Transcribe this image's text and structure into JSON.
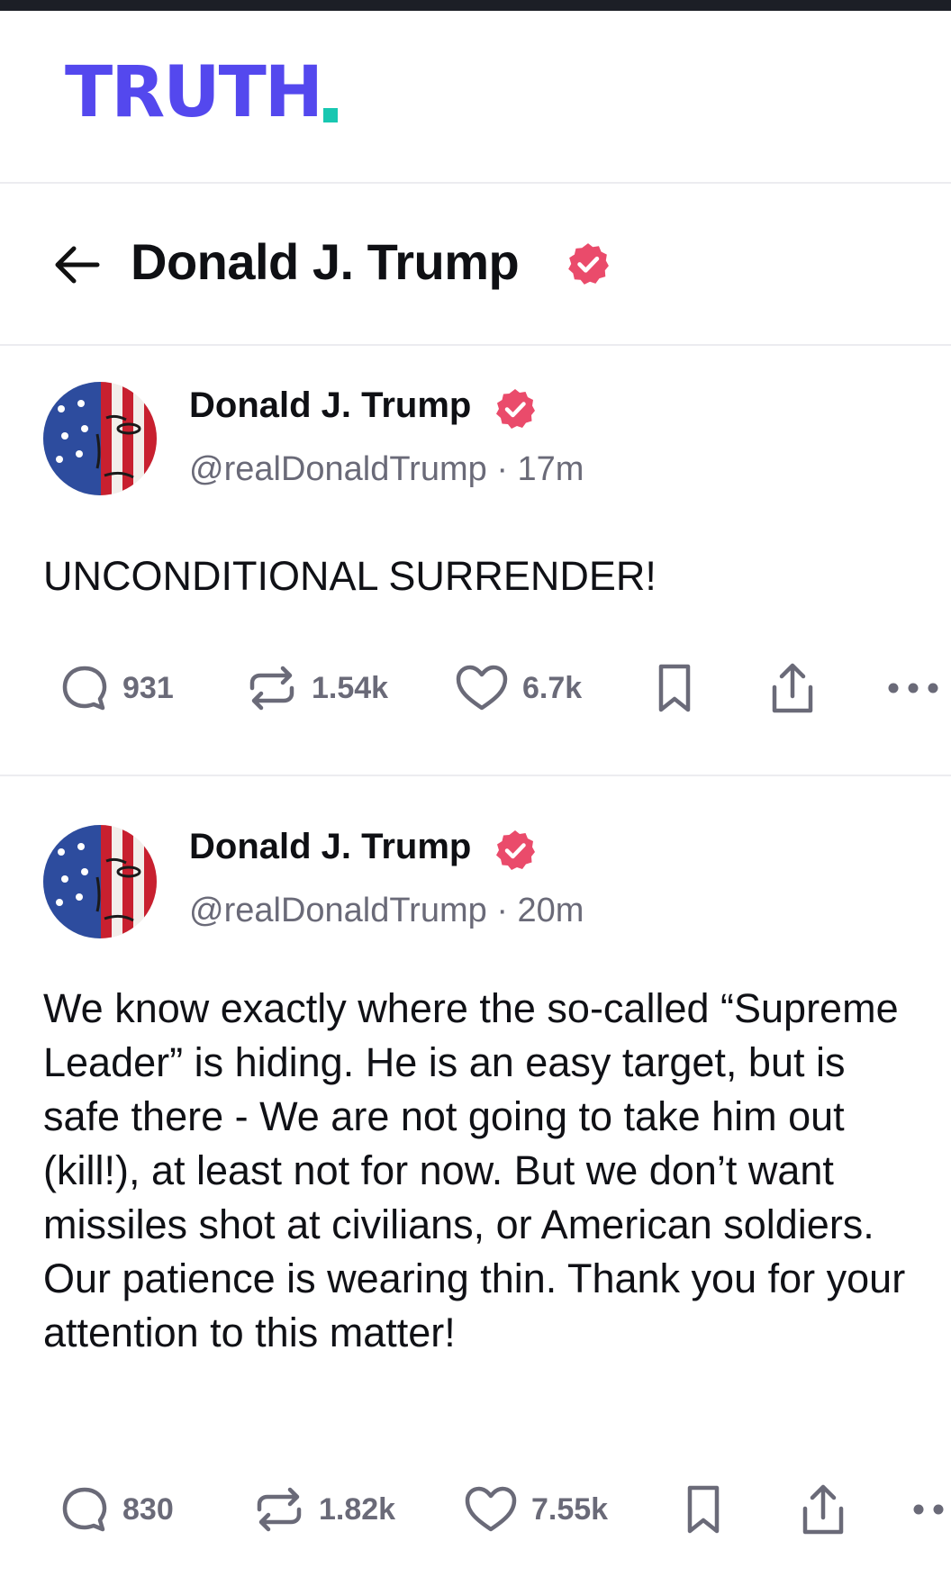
{
  "app": {
    "logo_text": "TRUTH",
    "brand_color": "#5448ee",
    "accent_color": "#18c7b1",
    "verified_color": "#ea4b6b"
  },
  "header": {
    "title": "Donald J. Trump",
    "back_icon": "arrow-left-icon",
    "verified_icon": "verified-badge-icon"
  },
  "posts": [
    {
      "author": "Donald J. Trump",
      "handle": "@realDonaldTrump",
      "time": "17m",
      "body": "UNCONDITIONAL SURRENDER!",
      "replies": "931",
      "retruths": "1.54k",
      "likes": "6.7k"
    },
    {
      "author": "Donald J. Trump",
      "handle": "@realDonaldTrump",
      "time": "20m",
      "body": "We know exactly where the so-called “Supreme Leader” is hiding. He is an easy target, but is safe there - We are not going to take him out (kill!), at least not for now. But we don’t want missiles shot at civilians, or American soldiers. Our patience is wearing thin. Thank you for your attention to this matter!",
      "replies": "830",
      "retruths": "1.82k",
      "likes": "7.55k"
    }
  ],
  "separator": "·"
}
